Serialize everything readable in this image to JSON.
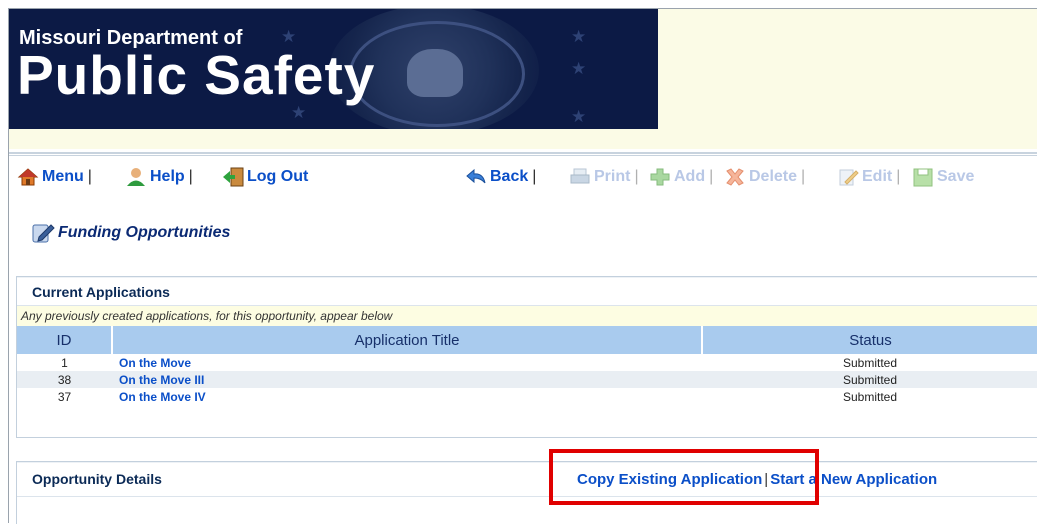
{
  "header": {
    "line1": "Missouri Department of",
    "line2": "Public Safety"
  },
  "toolbar": {
    "menu": "Menu",
    "help": "Help",
    "logout": "Log Out",
    "back": "Back",
    "print": "Print",
    "add": "Add",
    "delete": "Delete",
    "edit": "Edit",
    "save": "Save",
    "separator": "|"
  },
  "page": {
    "title": "Funding Opportunities"
  },
  "current_applications": {
    "heading": "Current Applications",
    "note": "Any previously created applications, for this opportunity, appear below",
    "columns": [
      "ID",
      "Application Title",
      "Status"
    ],
    "rows": [
      {
        "id": "1",
        "title": "On the Move",
        "status": "Submitted"
      },
      {
        "id": "38",
        "title": "On the Move III",
        "status": "Submitted"
      },
      {
        "id": "37",
        "title": "On the Move IV",
        "status": "Submitted"
      }
    ]
  },
  "opportunity_details": {
    "heading": "Opportunity Details",
    "copy_link": "Copy Existing Application",
    "separator": "|",
    "new_link": "Start a New Application"
  },
  "colors": {
    "banner": "#0c1a45",
    "link": "#0b4fc8",
    "highlight": "#e00000",
    "table_header": "#a9cbee"
  }
}
